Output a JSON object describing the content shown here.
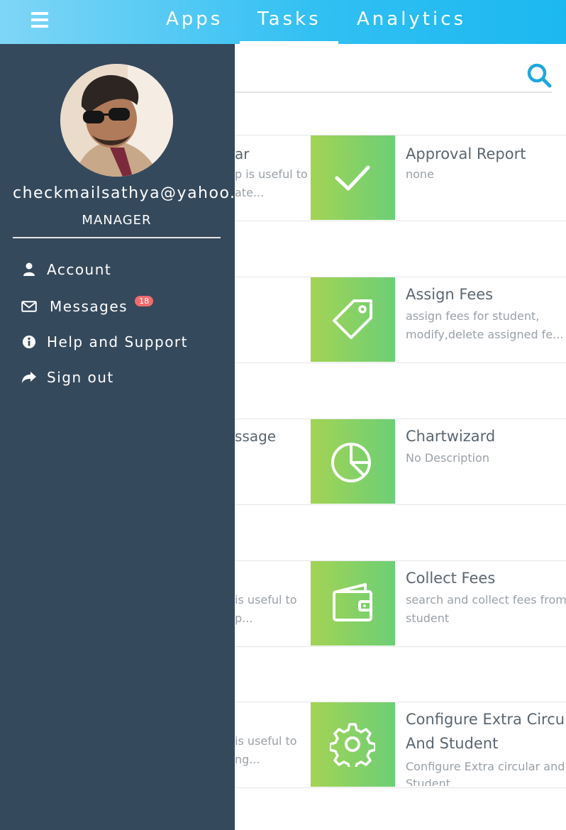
{
  "header": {
    "tabs": [
      {
        "label": "Apps"
      },
      {
        "label": "Tasks"
      },
      {
        "label": "Analytics"
      }
    ],
    "active_tab": "Tasks"
  },
  "drawer": {
    "email": "checkmailsathya@yahoo.com",
    "role": "MANAGER",
    "menu": [
      {
        "label": "Account",
        "icon": "user-icon"
      },
      {
        "label": "Messages",
        "icon": "envelope-icon",
        "badge": "18"
      },
      {
        "label": "Help and Support",
        "icon": "info-icon"
      },
      {
        "label": "Sign out",
        "icon": "share-icon"
      }
    ]
  },
  "left_fragments": [
    {
      "title": "ar",
      "desc1": "p is useful to",
      "desc2": "ate..."
    },
    {
      "title": "",
      "desc1": "",
      "desc2": ""
    },
    {
      "title": "ssage",
      "desc1": "",
      "desc2": ""
    },
    {
      "title": "",
      "desc1": "is useful to",
      "desc2": "p..."
    },
    {
      "title": "",
      "desc1": "is useful to",
      "desc2": "ng..."
    }
  ],
  "cards": [
    {
      "title": "Approval Report",
      "desc1": "none",
      "desc2": "",
      "icon": "check-icon"
    },
    {
      "title": "Assign Fees",
      "desc1": "assign fees for student,",
      "desc2": "modify,delete assigned fe...",
      "icon": "tag-icon"
    },
    {
      "title": "Chartwizard",
      "desc1": "No Description",
      "desc2": "",
      "icon": "pie-chart-icon"
    },
    {
      "title": "Collect Fees",
      "desc1": "search and collect fees from",
      "desc2": "student",
      "icon": "wallet-icon"
    },
    {
      "title": "Configure Extra Circul",
      "title2": "And Student",
      "desc1": "Configure Extra circular and",
      "desc2": "Student",
      "icon": "gear-icon"
    }
  ],
  "colors": {
    "header_start": "#7fd6f6",
    "header_end": "#1bb8f0",
    "drawer": "#35495c",
    "tile_start": "#a3d354",
    "tile_end": "#6ccf76",
    "badge": "#f06c6c",
    "search_icon": "#1ea7de"
  }
}
